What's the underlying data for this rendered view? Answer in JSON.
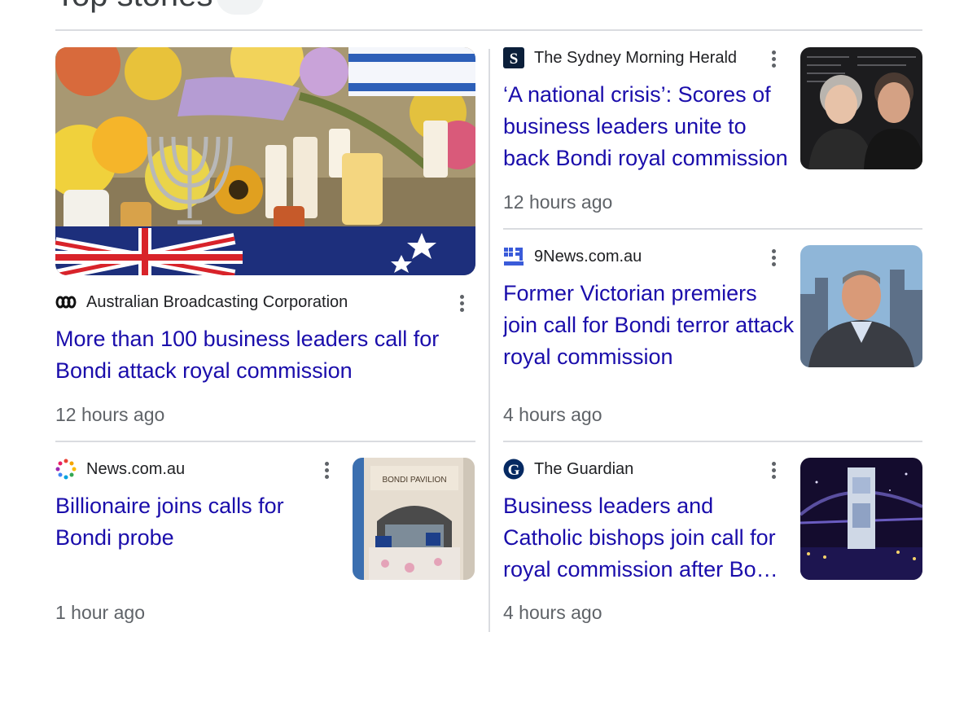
{
  "section": {
    "title": "Top stories"
  },
  "stories": [
    {
      "source": "Australian Broadcasting Corporation",
      "logo_icon": "abc-logo-icon",
      "headline": "More than 100 business leaders call for Bondi attack royal commission",
      "time": "12 hours ago",
      "image": "memorial-candles-flowers-flags"
    },
    {
      "source": "The Sydney Morning Herald",
      "logo_icon": "smh-logo-icon",
      "headline": "‘A national crisis’: Scores of business leaders unite to back Bondi royal commission",
      "time": "12 hours ago",
      "image": "two-business-leaders-portraits"
    },
    {
      "source": "9News.com.au",
      "logo_icon": "9news-logo-icon",
      "headline": "Former Victorian premiers join call for Bondi terror attack royal commission",
      "time": "4 hours ago",
      "image": "former-premier-interview"
    },
    {
      "source": "News.com.au",
      "logo_icon": "newscomau-logo-icon",
      "headline": "Billionaire joins calls for Bondi probe",
      "time": "1 hour ago",
      "image": "bondi-pavilion-memorial",
      "image_sign": "BONDI PAVILION"
    },
    {
      "source": "The Guardian",
      "logo_icon": "guardian-logo-icon",
      "headline": "Business leaders and Catholic bishops join call for royal commission after Bondi attack",
      "time": "4 hours ago",
      "image": "harbour-bridge-pylon-night"
    }
  ],
  "colors": {
    "link": "#1a0dab",
    "meta": "#5f6368",
    "divider": "#dadce0"
  }
}
